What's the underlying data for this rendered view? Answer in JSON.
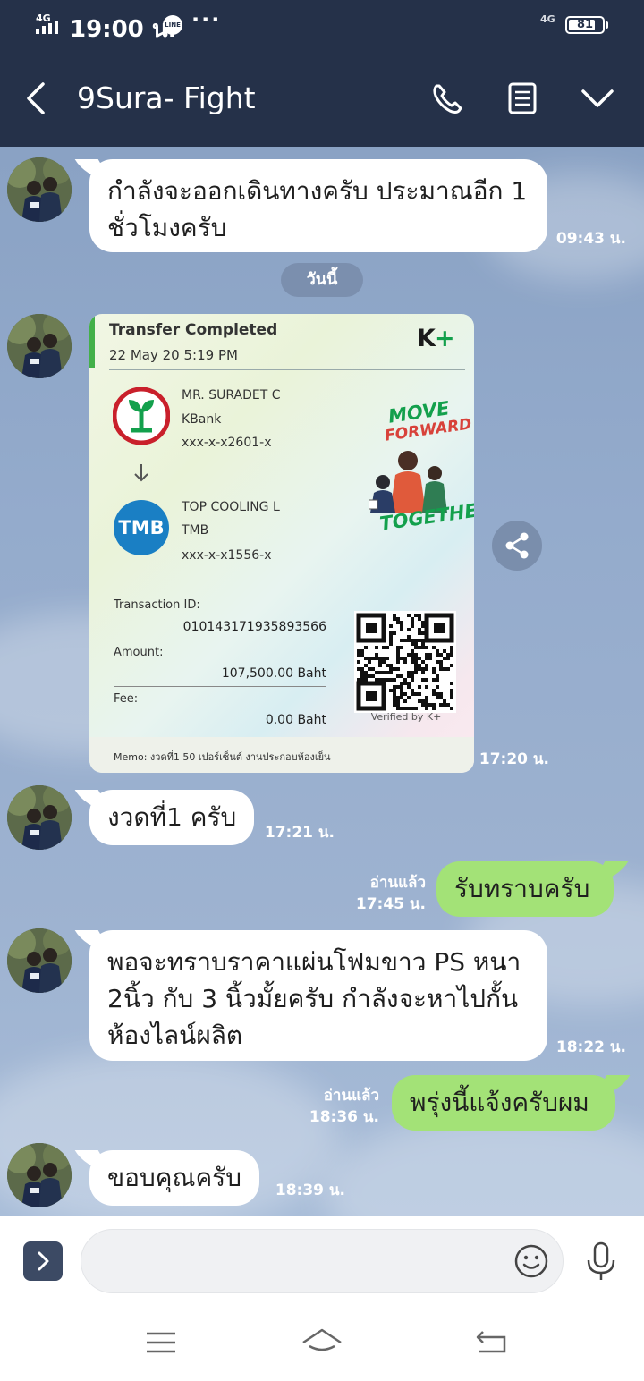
{
  "status_bar": {
    "network": "4G",
    "time": "19:00 น.",
    "line_badge": "LINE",
    "more": "···",
    "network_right": "4G",
    "battery_pct": "81"
  },
  "header": {
    "title": "9Sura- Fight"
  },
  "day_separator": "วันนี้",
  "messages": [
    {
      "text": "กำลังจะออกเดินทางครับ ประมาณอีก 1 ชั่วโมงครับ",
      "time": "09:43 น."
    },
    {
      "time": "17:20 น."
    },
    {
      "text": "งวดที่1 ครับ",
      "time": "17:21 น."
    },
    {
      "text": "รับทราบครับ",
      "read": "อ่านแล้ว",
      "time": "17:45 น."
    },
    {
      "text": "พอจะทราบราคาแผ่นโฟมขาว PS หนา 2นิ้ว กับ 3 นิ้วมั้ยครับ กำลังจะหาไปกั้นห้องไลน์ผลิต",
      "time": "18:22 น."
    },
    {
      "text": "พรุ่งนี้แจ้งครับผม",
      "read": "อ่านแล้ว",
      "time": "18:36 น."
    },
    {
      "text": "ขอบคุณครับ",
      "time": "18:39 น."
    }
  ],
  "transfer": {
    "title": "Transfer Completed",
    "date": "22 May 20  5:19 PM",
    "brand_k": "K",
    "brand_plus": "+",
    "from_name": "MR. SURADET C",
    "from_bank": "KBank",
    "from_acct": "xxx-x-x2601-x",
    "to_name": "TOP COOLING L",
    "to_bank": "TMB",
    "to_acct": "xxx-x-x1556-x",
    "to_logo": "TMB",
    "txn_label": "Transaction ID:",
    "txn_id": "010143171935893566",
    "amount_label": "Amount:",
    "amount": "107,500.00 Baht",
    "fee_label": "Fee:",
    "fee": "0.00 Baht",
    "memo": "Memo: งวดที่1 50 เปอร์เซ็นต์ งานประกอบห้องเย็น",
    "verified": "Verified by K+",
    "tag1": "MOVE",
    "tag2": "FORWARD",
    "tag3": "TOGETHER"
  },
  "colors": {
    "header_bg": "#253149",
    "outgoing_bubble": "#a3e277",
    "incoming_bubble": "#ffffff",
    "kbank_green": "#13a04c",
    "tmb_blue": "#1a7fc4"
  },
  "icons": [
    "back-icon",
    "phone-icon",
    "notes-icon",
    "chevron-down-icon",
    "share-icon",
    "expand-icon",
    "emoji-icon",
    "mic-icon",
    "menu-icon",
    "home-icon",
    "return-icon"
  ]
}
